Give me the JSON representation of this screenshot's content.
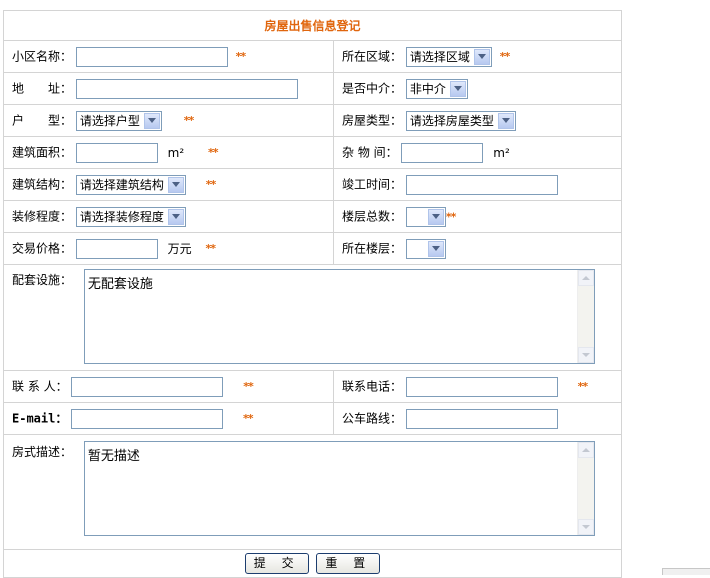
{
  "form": {
    "title": "房屋出售信息登记",
    "required_mark": "**",
    "community_name_label": "小区名称：",
    "region_label": "所在区域：",
    "region_select": "请选择区域",
    "address_label": "地　　址：",
    "agent_label": "是否中介：",
    "agent_select": "非中介",
    "layout_label": "户　　型：",
    "layout_select": "请选择户型",
    "house_type_label": "房屋类型：",
    "house_type_select": "请选择房屋类型",
    "area_label": "建筑面积：",
    "area_unit": "m²",
    "storage_label": "杂 物 间：",
    "storage_unit": "m²",
    "structure_label": "建筑结构：",
    "structure_select": "请选择建筑结构",
    "completion_label": "竣工时间：",
    "decoration_label": "装修程度：",
    "decoration_select": "请选择装修程度",
    "total_floors_label": "楼层总数：",
    "total_floors_select": "",
    "price_label": "交易价格：",
    "price_unit": "万元",
    "floor_label": "所在楼层：",
    "floor_select": "",
    "facilities_label": "配套设施：",
    "facilities_value": "无配套设施",
    "contact_label": "联 系 人：",
    "phone_label": "联系电话：",
    "email_label": "E-mail：",
    "bus_label": "公车路线：",
    "description_label": "房式描述：",
    "description_value": "暂无描述",
    "submit_label": "提 交",
    "reset_label": "重 置"
  }
}
